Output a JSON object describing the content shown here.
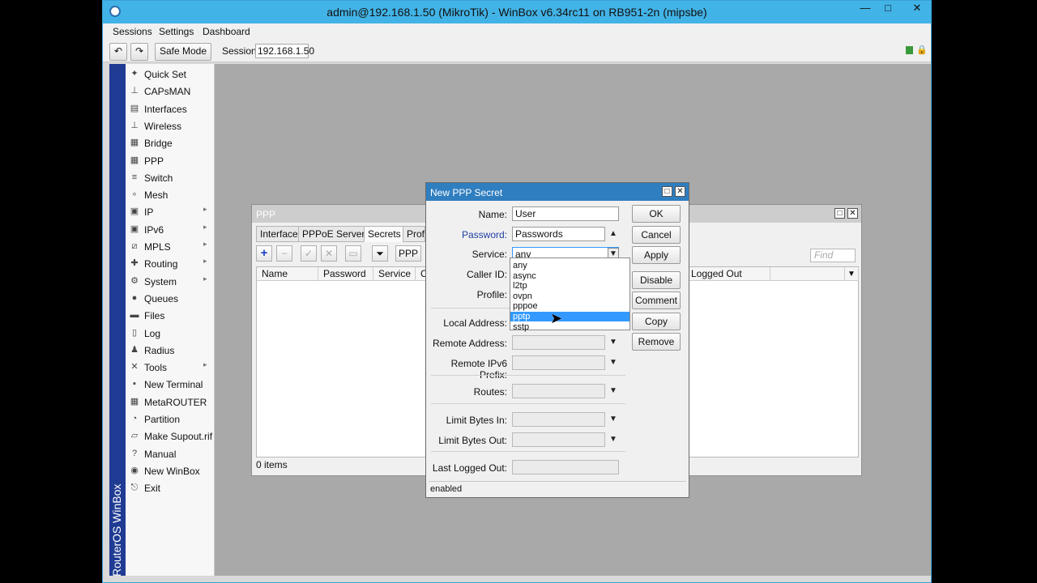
{
  "window": {
    "title": "admin@192.168.1.50 (MikroTik) - WinBox v6.34rc11 on RB951-2n (mipsbe)",
    "min": "—",
    "max": "□",
    "close": "✕"
  },
  "menubar": [
    "Sessions",
    "Settings",
    "Dashboard"
  ],
  "toolbar": {
    "undo": "↶",
    "redo": "↷",
    "safe_mode": "Safe Mode",
    "session_label": "Session:",
    "session_value": "192.168.1.50"
  },
  "brand": "RouterOS WinBox",
  "sidebar": {
    "items": [
      {
        "label": "Quick Set",
        "icon": "wand-icon",
        "glyph": "✦"
      },
      {
        "label": "CAPsMAN",
        "icon": "antenna-icon",
        "glyph": "⊥"
      },
      {
        "label": "Interfaces",
        "icon": "interfaces-icon",
        "glyph": "▤"
      },
      {
        "label": "Wireless",
        "icon": "wireless-icon",
        "glyph": "⊥"
      },
      {
        "label": "Bridge",
        "icon": "bridge-icon",
        "glyph": "▦"
      },
      {
        "label": "PPP",
        "icon": "ppp-icon",
        "glyph": "▦"
      },
      {
        "label": "Switch",
        "icon": "switch-icon",
        "glyph": "≡"
      },
      {
        "label": "Mesh",
        "icon": "mesh-icon",
        "glyph": "∘"
      },
      {
        "label": "IP",
        "icon": "ip-icon",
        "glyph": "▣",
        "arrow": true
      },
      {
        "label": "IPv6",
        "icon": "ipv6-icon",
        "glyph": "▣",
        "arrow": true
      },
      {
        "label": "MPLS",
        "icon": "mpls-icon",
        "glyph": "⧄",
        "arrow": true
      },
      {
        "label": "Routing",
        "icon": "routing-icon",
        "glyph": "✚",
        "arrow": true
      },
      {
        "label": "System",
        "icon": "gear-icon",
        "glyph": "⚙",
        "arrow": true
      },
      {
        "label": "Queues",
        "icon": "queues-icon",
        "glyph": "●"
      },
      {
        "label": "Files",
        "icon": "folder-icon",
        "glyph": "▬"
      },
      {
        "label": "Log",
        "icon": "log-icon",
        "glyph": "▯"
      },
      {
        "label": "Radius",
        "icon": "radius-icon",
        "glyph": "♟"
      },
      {
        "label": "Tools",
        "icon": "tools-icon",
        "glyph": "✕",
        "arrow": true
      },
      {
        "label": "New Terminal",
        "icon": "terminal-icon",
        "glyph": "▪"
      },
      {
        "label": "MetaROUTER",
        "icon": "metarouter-icon",
        "glyph": "▦"
      },
      {
        "label": "Partition",
        "icon": "partition-icon",
        "glyph": "◔"
      },
      {
        "label": "Make Supout.rif",
        "icon": "supout-icon",
        "glyph": "▱"
      },
      {
        "label": "Manual",
        "icon": "manual-icon",
        "glyph": "?"
      },
      {
        "label": "New WinBox",
        "icon": "winbox-icon",
        "glyph": "◉"
      },
      {
        "label": "Exit",
        "icon": "exit-icon",
        "glyph": "⎋"
      }
    ]
  },
  "ppp": {
    "title": "PPP",
    "tabs": [
      "Interface",
      "PPPoE Servers",
      "Secrets",
      "Profil"
    ],
    "toolbar_button": "PPP A",
    "find_placeholder": "Find",
    "columns": [
      "Name",
      "Password",
      "Service",
      "C",
      "Logged Out"
    ],
    "status": "0 items"
  },
  "dialog": {
    "title": "New PPP Secret",
    "fields": {
      "name": {
        "label": "Name:",
        "value": "User"
      },
      "password": {
        "label": "Password:",
        "value": "Passwords"
      },
      "service": {
        "label": "Service:",
        "value": "any"
      },
      "caller_id": {
        "label": "Caller ID:"
      },
      "profile": {
        "label": "Profile:"
      },
      "local_address": {
        "label": "Local Address:"
      },
      "remote_address": {
        "label": "Remote Address:"
      },
      "remote_ipv6_prefix": {
        "label": "Remote IPv6 Prefix:"
      },
      "routes": {
        "label": "Routes:"
      },
      "limit_bytes_in": {
        "label": "Limit Bytes In:"
      },
      "limit_bytes_out": {
        "label": "Limit Bytes Out:"
      },
      "last_logged_out": {
        "label": "Last Logged Out:"
      }
    },
    "buttons": [
      "OK",
      "Cancel",
      "Apply",
      "Disable",
      "Comment",
      "Copy",
      "Remove"
    ],
    "status": "enabled",
    "service_options": [
      "any",
      "async",
      "l2tp",
      "ovpn",
      "pppoe",
      "pptp",
      "sstp"
    ],
    "service_highlighted": "pptp"
  },
  "colors": {
    "title_bar": "#42b3e6",
    "dialog_title": "#2f7ec0",
    "brand_bar": "#1f3b93",
    "highlight": "#3399ff"
  }
}
